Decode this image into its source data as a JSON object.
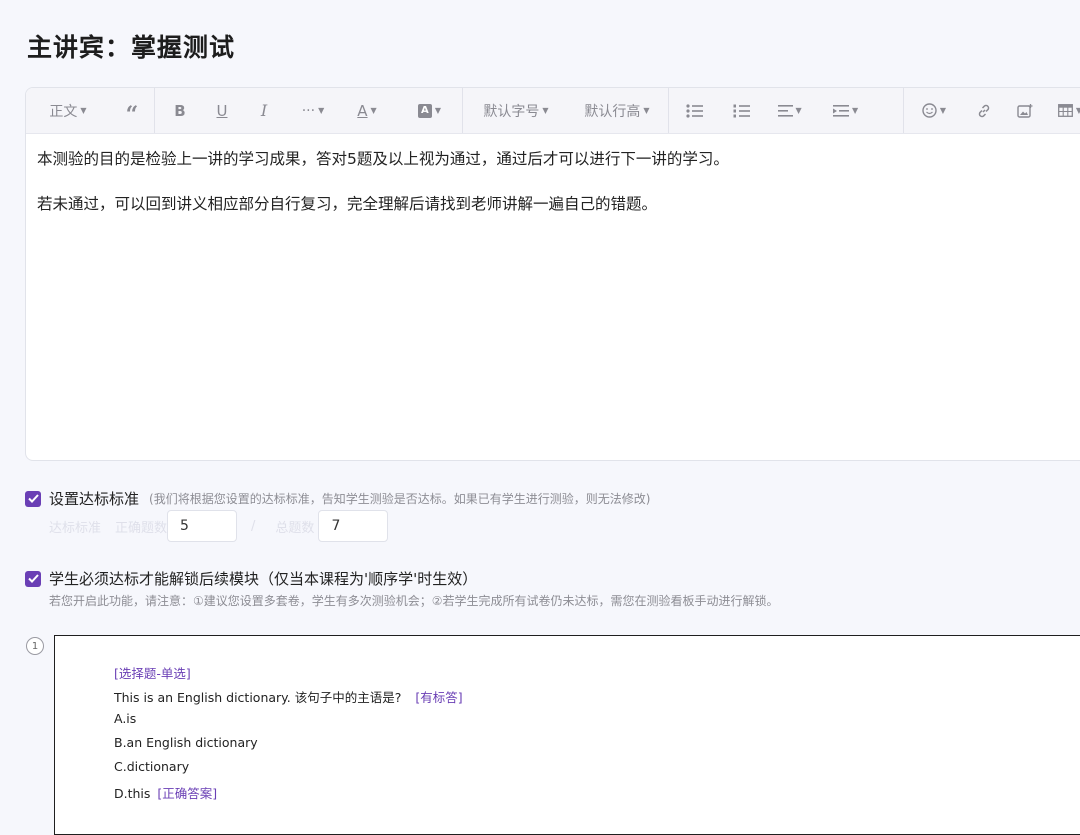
{
  "page_title": "主讲宾：掌握测试",
  "toolbar": {
    "paragraph": "正文",
    "font_size": "默认字号",
    "line_height": "默认行高"
  },
  "editor": {
    "paragraphs": [
      "本测验的目的是检验上一讲的学习成果，答对5题及以上视为通过，通过后才可以进行下一讲的学习。",
      "若未通过，可以回到讲义相应部分自行复习，完全理解后请找到老师讲解一遍自己的错题。"
    ]
  },
  "standard": {
    "checked": true,
    "label": "设置达标标准",
    "note": "(我们将根据您设置的达标标准，告知学生测验是否达标。如果已有学生进行测验，则无法修改)",
    "label_a": "达标标准",
    "label_b": "正确题数",
    "correct_value": "5",
    "separator": "/",
    "label_c": "总题数",
    "total_value": "7"
  },
  "unlock": {
    "checked": true,
    "label": "学生必须达标才能解锁后续模块（仅当本课程为'顺序学'时生效）",
    "note": "若您开启此功能，请注意：①建议您设置多套卷，学生有多次测验机会；②若学生完成所有试卷仍未达标，需您在测验看板手动进行解锁。"
  },
  "question": {
    "number": "1",
    "type_tag": "[选择题-单选]",
    "stem": "This is an English dictionary. 该句子中的主语是?",
    "stem_tag": "[有标答]",
    "options": [
      "A.is",
      "B.an English dictionary",
      "C.dictionary",
      "D.this"
    ],
    "answer_tag": "[正确答案]"
  },
  "colors": {
    "accent": "#6a3fb5",
    "background": "#f6f7fc"
  }
}
